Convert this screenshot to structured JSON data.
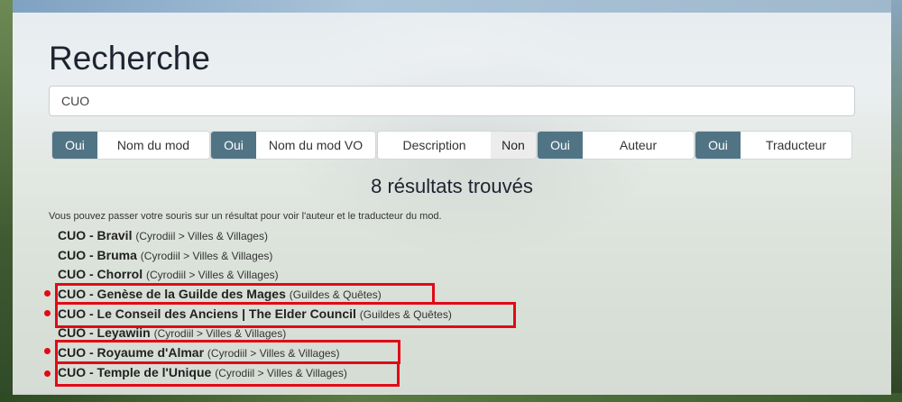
{
  "page": {
    "title": "Recherche"
  },
  "search": {
    "value": "CUO"
  },
  "filters": [
    {
      "toggle": "Oui",
      "state": "on",
      "label": "Nom du mod",
      "toggle_side": "left"
    },
    {
      "toggle": "Oui",
      "state": "on",
      "label": "Nom du mod VO",
      "toggle_side": "left"
    },
    {
      "toggle": "Non",
      "state": "off",
      "label": "Description",
      "toggle_side": "right"
    },
    {
      "toggle": "Oui",
      "state": "on",
      "label": "Auteur",
      "toggle_side": "left"
    },
    {
      "toggle": "Oui",
      "state": "on",
      "label": "Traducteur",
      "toggle_side": "left"
    }
  ],
  "results": {
    "count_text": "8 résultats trouvés",
    "hint": "Vous pouvez passer votre souris sur un résultat pour voir l'auteur et le traducteur du mod.",
    "items": [
      {
        "name": "CUO - Bravil",
        "category": "(Cyrodiil > Villes & Villages)",
        "highlighted": false
      },
      {
        "name": "CUO - Bruma",
        "category": "(Cyrodiil > Villes & Villages)",
        "highlighted": false
      },
      {
        "name": "CUO - Chorrol",
        "category": "(Cyrodiil > Villes & Villages)",
        "highlighted": false
      },
      {
        "name": "CUO - Genèse de la Guilde des Mages",
        "category": "(Guildes & Quêtes)",
        "highlighted": true
      },
      {
        "name": "CUO - Le Conseil des Anciens | The Elder Council",
        "category": "(Guildes & Quêtes)",
        "highlighted": true
      },
      {
        "name": "CUO - Leyawiin",
        "category": "(Cyrodiil > Villes & Villages)",
        "highlighted": false
      },
      {
        "name": "CUO - Royaume d'Almar",
        "category": "(Cyrodiil > Villes & Villages)",
        "highlighted": true
      },
      {
        "name": "CUO - Temple de l'Unique",
        "category": "(Cyrodiil > Villes & Villages)",
        "highlighted": true
      }
    ]
  },
  "colors": {
    "toggle_on": "#517485",
    "annotation": "#e00b17"
  }
}
